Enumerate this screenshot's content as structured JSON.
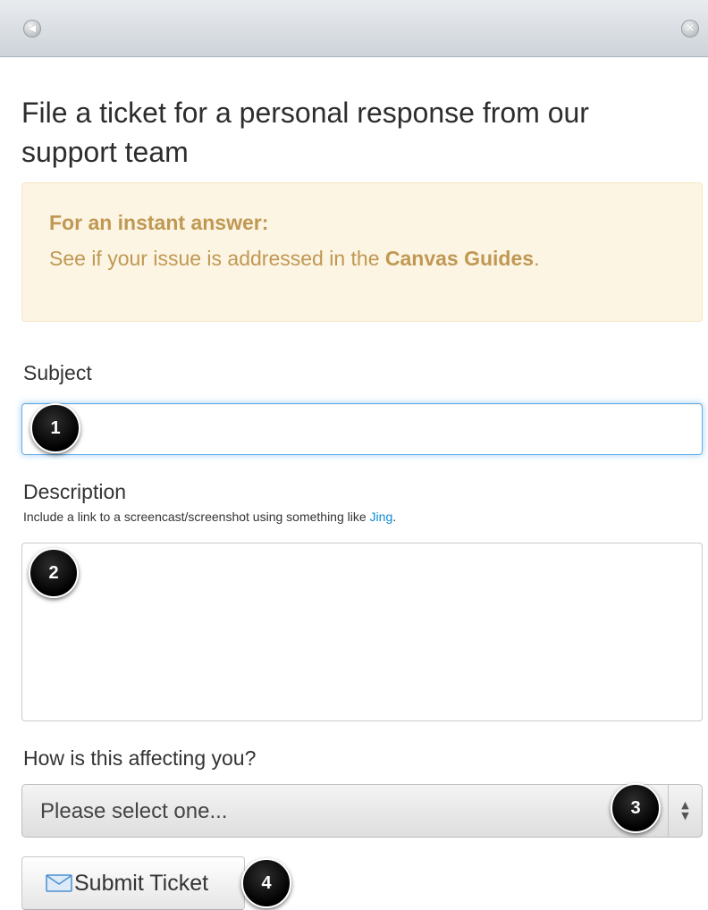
{
  "window": {
    "back_icon": "back-arrow-icon",
    "close_icon": "close-icon"
  },
  "page_title": "File a ticket for a personal response from our support team",
  "alert": {
    "heading": "For an instant answer:",
    "text_before": "See if your issue is addressed in the ",
    "link_text": "Canvas Guides",
    "text_after": "."
  },
  "subject": {
    "label": "Subject",
    "value": "",
    "placeholder": ""
  },
  "description": {
    "label": "Description",
    "help_before": "Include a link to a screencast/screenshot using something like ",
    "help_link": "Jing",
    "help_after": ".",
    "value": ""
  },
  "impact": {
    "label": "How is this affecting you?",
    "selected": "Please select one..."
  },
  "submit": {
    "label": "Submit Ticket",
    "icon": "envelope-icon"
  },
  "callouts": [
    "1",
    "2",
    "3",
    "4"
  ],
  "colors": {
    "alert_bg": "#fcf5e3",
    "alert_text": "#c09853",
    "link": "#0a8bd6",
    "focus_border": "#66afe9"
  }
}
